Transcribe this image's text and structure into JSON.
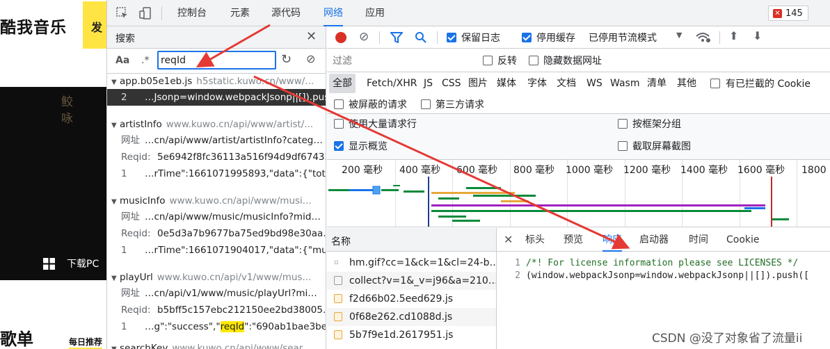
{
  "website": {
    "title": "酷我音乐",
    "yellow_label": "发",
    "download_pc": "下载PC",
    "playlist_title": "歌单",
    "daily_recommend": "每日推荐"
  },
  "devtools_tabs": [
    "控制台",
    "元素",
    "源代码",
    "网络",
    "应用"
  ],
  "active_tab": "网络",
  "error_count": "145",
  "search": {
    "title": "搜索",
    "aa": "Aa",
    "regex": ".*",
    "query": "reqId",
    "results": [
      {
        "file": "app.b05e1eb.js",
        "domain": "h5static.kuwo.cn/www/...",
        "lines": [
          {
            "num": "2",
            "pre": "…Jsonp=window.webpackJsonp||[]).pus…",
            "hit": "",
            "post": ""
          }
        ]
      },
      {
        "file": "artistInfo",
        "domain": "www.kuwo.cn/api/www/artist/...",
        "lines": [
          {
            "num": "网址",
            "pre": "…cn/api/www/artist/artistInfo?categ…",
            "hit": "",
            "post": ""
          },
          {
            "num": "Reqid:",
            "pre": "5e6942f8fc36113a516f94d9df67433f",
            "hit": "",
            "post": ""
          },
          {
            "num": "1",
            "pre": "…rTime\":1661071995893,\"data\":{\"total\":…",
            "hit": "",
            "post": ""
          }
        ]
      },
      {
        "file": "musicInfo",
        "domain": "www.kuwo.cn/api/www/musi...",
        "lines": [
          {
            "num": "网址",
            "pre": "…cn/api/www/music/musicInfo?mid…",
            "hit": "",
            "post": ""
          },
          {
            "num": "Reqid:",
            "pre": "0e5d3a7b9677ba75ed9bd98e30aa…",
            "hit": "",
            "post": ""
          },
          {
            "num": "1",
            "pre": "…rTime\":1661071904017,\"data\":{\"musicr…",
            "hit": "",
            "post": ""
          }
        ]
      },
      {
        "file": "playUrl",
        "domain": "www.kuwo.cn/api/v1/www/mus...",
        "lines": [
          {
            "num": "网址",
            "pre": "…cn/api/v1/www/music/playUrl?mi…",
            "hit": "",
            "post": ""
          },
          {
            "num": "Reqid:",
            "pre": "b5bff5c157ebc212150ee2bd38005…",
            "hit": "",
            "post": ""
          },
          {
            "num": "1",
            "pre": "…g\":\"success\",\"",
            "hit": "reqId",
            "post": "\":\"690ab1bae3be6f…"
          }
        ]
      },
      {
        "file": "searchKey",
        "domain": "www.kuwo.cn/api/www/sear...",
        "lines": []
      }
    ]
  },
  "network": {
    "toolbar": {
      "preserve_log": "保留日志",
      "disable_cache": "停用缓存",
      "throttle": "已停用节流模式"
    },
    "filter_placeholder": "过滤",
    "invert": "反转",
    "hide_data_urls": "隐藏数据网址",
    "types": [
      "全部",
      "Fetch/XHR",
      "JS",
      "CSS",
      "图片",
      "媒体",
      "字体",
      "文档",
      "WS",
      "Wasm",
      "清单",
      "其他"
    ],
    "blocked_cookies": "有已拦截的 Cookie",
    "blocked_requests": "被屏蔽的请求",
    "third_party": "第三方请求",
    "large_rows": "使用大量请求行",
    "group_by_frame": "按框架分组",
    "show_overview": "显示概览",
    "capture_screenshots": "截取屏幕截图",
    "timeline_ticks": [
      "200 毫秒",
      "400 毫秒",
      "600 毫秒",
      "800 毫秒",
      "1000 毫秒",
      "1200 毫秒",
      "1400 毫秒",
      "1600 毫秒",
      "1800 毫秒"
    ],
    "name_header": "名称",
    "requests": [
      {
        "name": "hm.gif?cc=1&ck=1&cl=24-b…",
        "kind": "other"
      },
      {
        "name": "collect?v=1&_v=j96&a=210…",
        "kind": "doc"
      },
      {
        "name": "f2d66b02.5eed629.js",
        "kind": "js"
      },
      {
        "name": "0f68e262.cd1088d.js",
        "kind": "js"
      },
      {
        "name": "5b7f9e1d.2617951.js",
        "kind": "js"
      }
    ],
    "detail_tabs": [
      "标头",
      "预览",
      "响应",
      "启动器",
      "时间",
      "Cookie"
    ],
    "active_detail_tab": "响应",
    "response_lines": [
      {
        "num": "1",
        "text": "/*! For license information please see LICENSES */",
        "kind": "comment"
      },
      {
        "num": "2",
        "text": "(window.webpackJsonp=window.webpackJsonp||[]).push([",
        "kind": "code"
      }
    ]
  },
  "watermark": "CSDN @没了对象省了流量ii",
  "colors": {
    "accent": "#1a73e8",
    "record": "#d93025",
    "annotation_arrow": "#e53935",
    "highlight": "#ffe800"
  }
}
